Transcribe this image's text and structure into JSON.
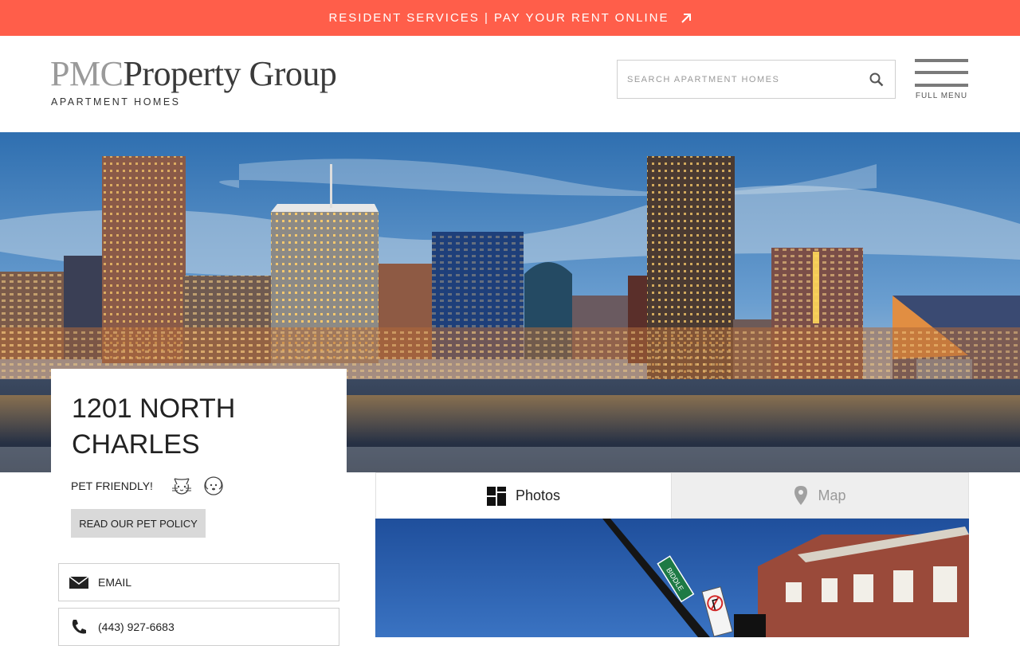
{
  "top_banner": {
    "text": "RESIDENT SERVICES | PAY YOUR RENT ONLINE",
    "icon": "arrow-up-right-icon"
  },
  "logo": {
    "brand_prefix": "PMC",
    "brand_name": "Property Group",
    "tagline": "APARTMENT HOMES"
  },
  "search": {
    "placeholder": "SEARCH APARTMENT HOMES",
    "icon": "search-icon"
  },
  "menu": {
    "label": "FULL MENU",
    "icon": "hamburger-icon"
  },
  "property": {
    "title_line1": "1201 NORTH",
    "title_line2": "CHARLES",
    "pet_label": "PET FRIENDLY!",
    "pet_icons": [
      "cat-icon",
      "dog-icon"
    ],
    "pet_policy_button": "READ OUR PET POLICY",
    "contacts": [
      {
        "icon": "envelope-icon",
        "label": "EMAIL"
      },
      {
        "icon": "phone-icon",
        "label": "(443) 927-6683"
      }
    ]
  },
  "media_tabs": [
    {
      "label": "Photos",
      "icon": "photos-grid-icon",
      "active": true
    },
    {
      "label": "Map",
      "icon": "map-pin-icon",
      "active": false
    }
  ],
  "street_sign_text": "BIDDLE",
  "colors": {
    "banner": "#ff5e4a",
    "accent_text": "#222222"
  }
}
